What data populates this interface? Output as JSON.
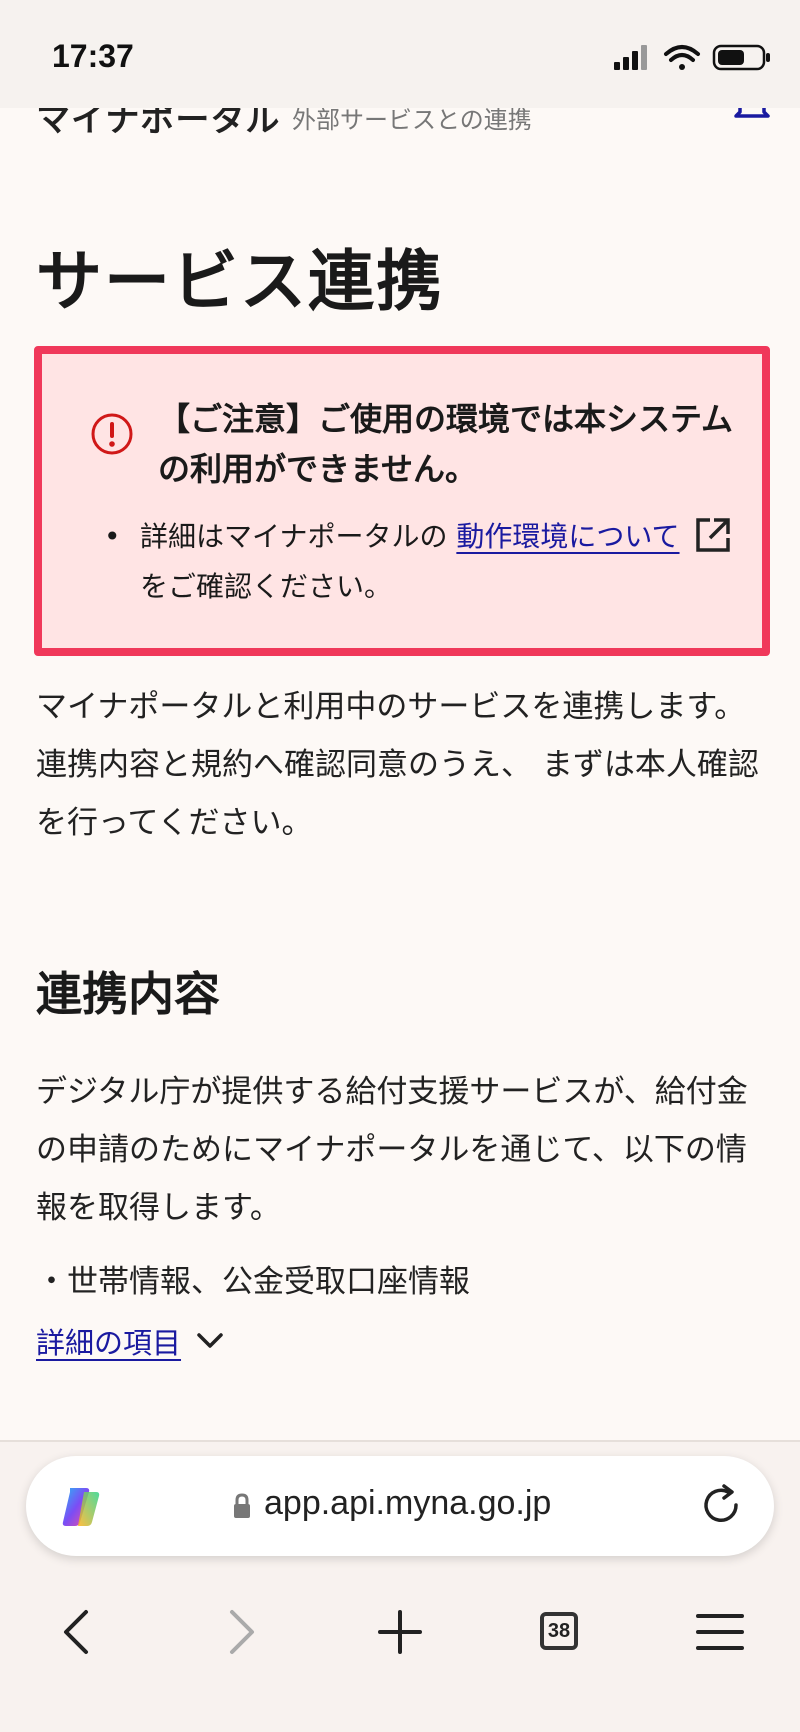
{
  "status_bar": {
    "time": "17:37"
  },
  "header": {
    "brand": "マイナポータル",
    "subtitle": "外部サービスとの連携"
  },
  "page_title": "サービス連携",
  "alert": {
    "title": "【ご注意】ご使用の環境では本システムの利用ができません。",
    "bullet_prefix": "詳細はマイナポータルの",
    "bullet_link": "動作環境について",
    "bullet_suffix": "をご確認ください。"
  },
  "intro": "マイナポータルと利用中のサービスを連携します。連携内容と規約へ確認同意のうえ、 まずは本人確認を行ってください。",
  "section": {
    "title": "連携内容",
    "text": "デジタル庁が提供する給付支援サービスが、給付金の申請のためにマイナポータルを通じて、以下の情報を取得します。",
    "item": "・世帯情報、公金受取口座情報",
    "details_link": "詳細の項目"
  },
  "browser": {
    "url": "app.api.myna.go.jp",
    "tab_count": "38"
  },
  "colors": {
    "alert_border": "#f0385a",
    "alert_background": "#ffe4e4",
    "link": "#1a1aa0"
  }
}
